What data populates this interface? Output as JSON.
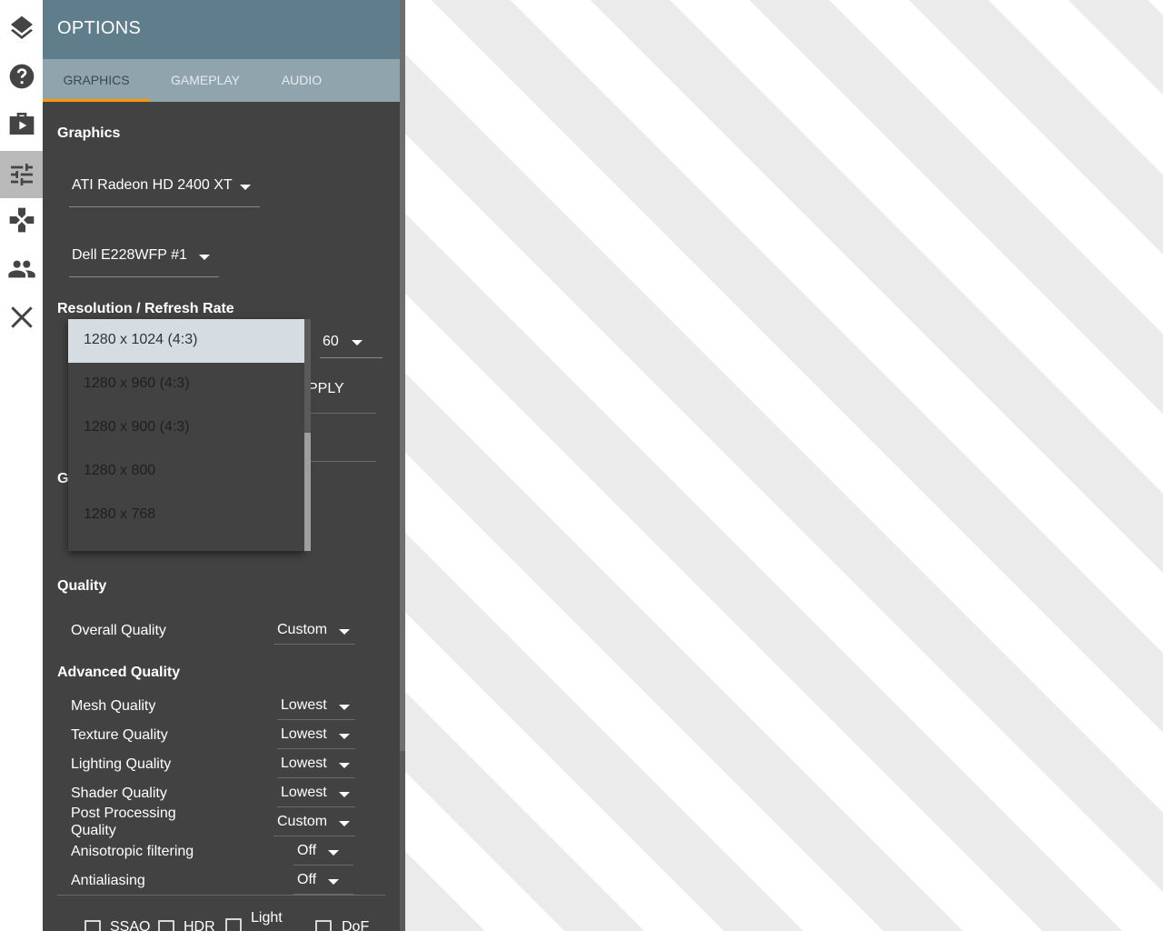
{
  "header": {
    "title": "OPTIONS"
  },
  "tabs": [
    {
      "label": "GRAPHICS",
      "active": true
    },
    {
      "label": "GAMEPLAY",
      "active": false
    },
    {
      "label": "AUDIO",
      "active": false
    }
  ],
  "rail": {
    "icons": [
      "layers-icon",
      "help-icon",
      "video-library-icon",
      "tune-icon",
      "gamepad-icon",
      "people-icon",
      "close-icon"
    ]
  },
  "graphics": {
    "section_title": "Graphics",
    "adapter": "ATI Radeon HD 2400 XT",
    "monitor": "Dell E228WFP #1"
  },
  "resolution": {
    "section_title": "Resolution / Refresh Rate",
    "refresh_rate": "60",
    "apply_partial": "PPLY",
    "hidden_section_initial": "G",
    "options": [
      "1280 x 1024 (4:3)",
      "1280 x 960 (4:3)",
      "1280 x 900 (4:3)",
      "1280 x 800",
      "1280 x 768"
    ]
  },
  "quality": {
    "section_title": "Quality",
    "overall_label": "Overall Quality",
    "overall_value": "Custom"
  },
  "advanced": {
    "section_title": "Advanced Quality",
    "rows": [
      {
        "label": "Mesh Quality",
        "value": "Lowest"
      },
      {
        "label": "Texture Quality",
        "value": "Lowest"
      },
      {
        "label": "Lighting Quality",
        "value": "Lowest"
      },
      {
        "label": "Shader Quality",
        "value": "Lowest"
      },
      {
        "label": "Post Processing Quality",
        "value": "Custom"
      },
      {
        "label": "Anisotropic filtering",
        "value": "Off"
      },
      {
        "label": "Antialiasing",
        "value": "Off"
      }
    ]
  },
  "effects": {
    "ssao": "SSAO",
    "hdr": "HDR",
    "light": "Light",
    "dof": "DoF"
  },
  "colors": {
    "header": "#607d8b",
    "tabs": "#90a4ae",
    "panel": "#424242",
    "tab_ink": "#ff9800"
  }
}
